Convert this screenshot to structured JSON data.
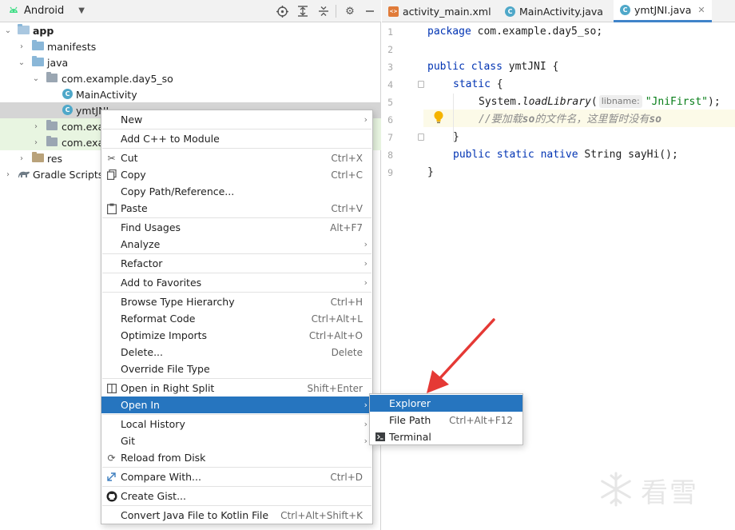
{
  "project_panel": {
    "view_label": "Android",
    "tree": [
      {
        "label": "app"
      },
      {
        "label": "manifests"
      },
      {
        "label": "java"
      },
      {
        "label": "com.example.day5_so"
      },
      {
        "label": "MainActivity"
      },
      {
        "label": "ymtJNI"
      },
      {
        "label": "com.exa"
      },
      {
        "label": "com.exa"
      },
      {
        "label": "res"
      },
      {
        "label": "Gradle Scripts"
      }
    ]
  },
  "tabs": [
    {
      "label": "activity_main.xml",
      "icon": "xml-file-icon"
    },
    {
      "label": "MainActivity.java",
      "icon": "java-class-icon"
    },
    {
      "label": "ymtJNI.java",
      "icon": "java-class-icon",
      "active": true
    }
  ],
  "editor": {
    "line_numbers": [
      "1",
      "2",
      "3",
      "4",
      "5",
      "6",
      "7",
      "8",
      "9"
    ],
    "code": {
      "l1_kw": "package",
      "l1_rest": " com.example.day5_so;",
      "l3_kw": "public class",
      "l3_rest": " ymtJNI {",
      "l4_kw": "static",
      "l4_rest": " {",
      "l5_obj": "System.",
      "l5_method": "loadLibrary",
      "l5_open": "(",
      "l5_hint": "libname:",
      "l5_str": "\"JniFirst\"",
      "l5_close": ");",
      "l6_a": "//要加载",
      "l6_b": "so",
      "l6_c": "的文件名，这里暂时没有",
      "l6_d": "so",
      "l7": "}",
      "l8_kw": "public static native",
      "l8_rest": " String sayHi();",
      "l9": "}"
    }
  },
  "context_menu": {
    "items": [
      {
        "label": "New",
        "shortcut": "",
        "submenu": true
      },
      {
        "label": "Add C++ to Module",
        "shortcut": ""
      },
      {
        "label": "Cut",
        "shortcut": "Ctrl+X",
        "icon": "scissors-icon"
      },
      {
        "label": "Copy",
        "shortcut": "Ctrl+C",
        "icon": "copy-icon"
      },
      {
        "label": "Copy Path/Reference...",
        "shortcut": ""
      },
      {
        "label": "Paste",
        "shortcut": "Ctrl+V",
        "icon": "clipboard-icon"
      },
      {
        "label": "Find Usages",
        "shortcut": "Alt+F7"
      },
      {
        "label": "Analyze",
        "shortcut": "",
        "submenu": true
      },
      {
        "label": "Refactor",
        "shortcut": "",
        "submenu": true
      },
      {
        "label": "Add to Favorites",
        "shortcut": "",
        "submenu": true
      },
      {
        "label": "Browse Type Hierarchy",
        "shortcut": "Ctrl+H"
      },
      {
        "label": "Reformat Code",
        "shortcut": "Ctrl+Alt+L"
      },
      {
        "label": "Optimize Imports",
        "shortcut": "Ctrl+Alt+O"
      },
      {
        "label": "Delete...",
        "shortcut": "Delete"
      },
      {
        "label": "Override File Type",
        "shortcut": ""
      },
      {
        "label": "Open in Right Split",
        "shortcut": "Shift+Enter",
        "icon": "split-icon"
      },
      {
        "label": "Open In",
        "shortcut": "",
        "submenu": true,
        "highlighted": true
      },
      {
        "label": "Local History",
        "shortcut": "",
        "submenu": true
      },
      {
        "label": "Git",
        "shortcut": "",
        "submenu": true
      },
      {
        "label": "Reload from Disk",
        "shortcut": "",
        "icon": "reload-icon"
      },
      {
        "label": "Compare With...",
        "shortcut": "Ctrl+D",
        "icon": "compare-icon"
      },
      {
        "label": "Create Gist...",
        "shortcut": "",
        "icon": "github-icon"
      },
      {
        "label": "Convert Java File to Kotlin File",
        "shortcut": "Ctrl+Alt+Shift+K"
      }
    ]
  },
  "submenu": {
    "items": [
      {
        "label": "Explorer",
        "shortcut": "",
        "highlighted": true
      },
      {
        "label": "File Path",
        "shortcut": "Ctrl+Alt+F12"
      },
      {
        "label": "Terminal",
        "shortcut": "",
        "icon": "terminal-icon"
      }
    ]
  },
  "watermark": {
    "text": "看雪"
  },
  "colors": {
    "selection_blue": "#2675bf",
    "annotation_red": "#e53935",
    "keyword": "#0033b3",
    "string": "#067d17"
  }
}
